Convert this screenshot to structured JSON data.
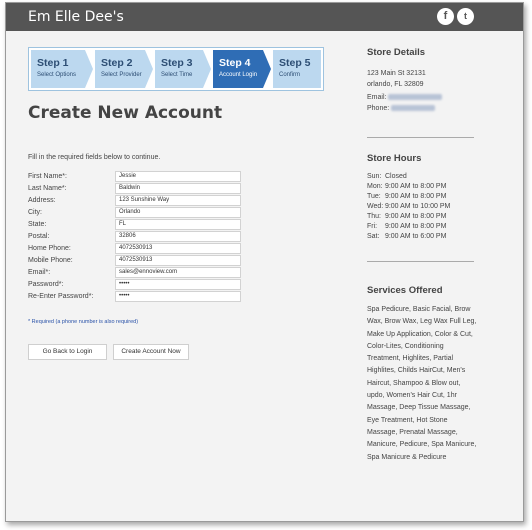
{
  "header": {
    "brand": "Em Elle Dee's",
    "social": [
      "facebook-icon",
      "twitter-icon"
    ]
  },
  "steps": [
    {
      "num": "Step 1",
      "sub": "Select Options",
      "active": false
    },
    {
      "num": "Step 2",
      "sub": "Select Provider",
      "active": false
    },
    {
      "num": "Step 3",
      "sub": "Select Time",
      "active": false
    },
    {
      "num": "Step 4",
      "sub": "Account Login",
      "active": true
    },
    {
      "num": "Step 5",
      "sub": "Confirm",
      "active": false
    }
  ],
  "form": {
    "title": "Create New Account",
    "intro": "Fill in the required fields below to continue.",
    "fields": [
      {
        "label": "First Name*:",
        "value": "Jessie"
      },
      {
        "label": "Last Name*:",
        "value": "Baldwin"
      },
      {
        "label": "Address:",
        "value": "123 Sunshine Way"
      },
      {
        "label": "City:",
        "value": "Orlando"
      },
      {
        "label": "State:",
        "value": "FL"
      },
      {
        "label": "Postal:",
        "value": "32806"
      },
      {
        "label": "Home Phone:",
        "value": "4072530913"
      },
      {
        "label": "Mobile Phone:",
        "value": "4072530913"
      },
      {
        "label": "Email*:",
        "value": "sales@ennoview.com"
      },
      {
        "label": "Password*:",
        "value": "•••••"
      },
      {
        "label": "Re-Enter Password*:",
        "value": "•••••"
      }
    ],
    "required_note": "* Required (a phone number is also required)",
    "back_button": "Go Back to Login",
    "create_button": "Create Account Now"
  },
  "store": {
    "details_heading": "Store Details",
    "address_line1": "123 Main St 32131",
    "address_line2": "orlando, FL 32809",
    "email_label": "Email:",
    "phone_label": "Phone:",
    "hours_heading": "Store Hours",
    "hours": [
      {
        "day": "Sun:",
        "time": "Closed"
      },
      {
        "day": "Mon:",
        "time": "9:00 AM  to  8:00 PM"
      },
      {
        "day": "Tue:",
        "time": "9:00 AM  to  8:00 PM"
      },
      {
        "day": "Wed:",
        "time": "9:00 AM  to  10:00 PM"
      },
      {
        "day": "Thu:",
        "time": "9:00 AM  to  8:00 PM"
      },
      {
        "day": "Fri:",
        "time": "9:00 AM  to  8:00 PM"
      },
      {
        "day": "Sat:",
        "time": "9:00 AM  to  6:00 PM"
      }
    ],
    "services_heading": "Services Offered",
    "services": "Spa Pedicure, Basic Facial, Brow Wax, Brow Wax, Leg Wax Full Leg, Make Up Application, Color & Cut, Color-Lites, Conditioning Treatment, Highlites, Partial Highlites, Childs HairCut, Men's Haircut, Shampoo & Blow out, updo, Women's Hair Cut, 1hr Massage, Deep Tissue Massage, Eye Treatment, Hot Stone Massage, Prenatal Massage, Manicure, Pedicure, Spa Manicure, Spa Manicure & Pedicure"
  }
}
